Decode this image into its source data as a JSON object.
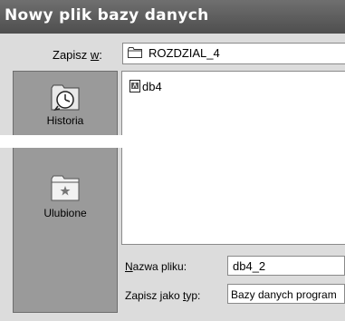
{
  "window": {
    "title": "Nowy plik bazy danych"
  },
  "save_in": {
    "label_prefix": "Zapisz ",
    "label_underlined": "w",
    "label_suffix": ":",
    "value": "ROZDZIAL_4"
  },
  "places": [
    {
      "label": "Historia",
      "icon": "history-clock-icon"
    },
    {
      "label": "Ulubione",
      "icon": "favorites-folder-icon"
    }
  ],
  "files": [
    {
      "name": "db4",
      "icon": "access-file-icon"
    }
  ],
  "file_name": {
    "label_underlined": "N",
    "label_rest": "azwa pliku:",
    "value": "db4_2"
  },
  "save_type": {
    "label_prefix": "Zapisz jako ",
    "label_underlined": "t",
    "label_rest": "yp:",
    "value": "Bazy danych program"
  }
}
